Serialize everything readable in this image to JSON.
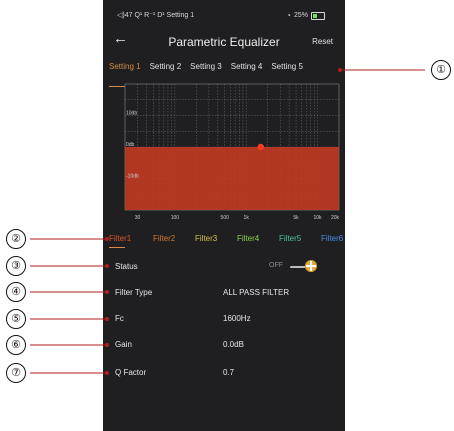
{
  "status_bar": {
    "left": "◁)47 Q¹ R⁻¹ D¹ Setting 1",
    "wifi": "wifi-icon",
    "battery_percent": "25%"
  },
  "header": {
    "title": "Parametric Equalizer",
    "reset_label": "Reset",
    "back_icon": "back-arrow-icon"
  },
  "presets": [
    "Setting 1",
    "Setting 2",
    "Setting 3",
    "Setting 4",
    "Setting 5"
  ],
  "chart_data": {
    "type": "area",
    "x_ticks": [
      "30",
      "100",
      "500",
      "1k",
      "5k",
      "10k",
      "20k"
    ],
    "y_ticks": [
      "10db",
      "0db",
      "-10db"
    ],
    "x_scale": "log",
    "x_range": [
      20,
      20000
    ],
    "y_range": [
      -20,
      20
    ],
    "series": [
      {
        "x": [
          20,
          20000
        ],
        "y": [
          0,
          0
        ]
      }
    ],
    "marker": {
      "x": 1600,
      "y": 0
    },
    "colors": {
      "fill": "#c23a24",
      "marker": "#ff3b1f",
      "grid": "#6e6e6e",
      "background": "#1f1f21"
    }
  },
  "filters": [
    "Filter1",
    "Filter2",
    "Filter3",
    "Filter4",
    "Filter5",
    "Filter6"
  ],
  "filter_colors": [
    "#e0502e",
    "#d7792f",
    "#d2c34c",
    "#8dd14b",
    "#49c39a",
    "#4a8ee6"
  ],
  "params": {
    "status_label": "Status",
    "status_value": "OFF",
    "filter_type_label": "Filter Type",
    "filter_type_value": "ALL PASS FILTER",
    "fc_label": "Fc",
    "fc_value": "1600Hz",
    "gain_label": "Gain",
    "gain_value": "0.0dB",
    "q_label": "Q Factor",
    "q_value": "0.7"
  },
  "callouts": [
    "①",
    "②",
    "③",
    "④",
    "⑤",
    "⑥",
    "⑦"
  ],
  "colors": {
    "accent": "#d58b46",
    "callout_line": "#b01d1d"
  }
}
